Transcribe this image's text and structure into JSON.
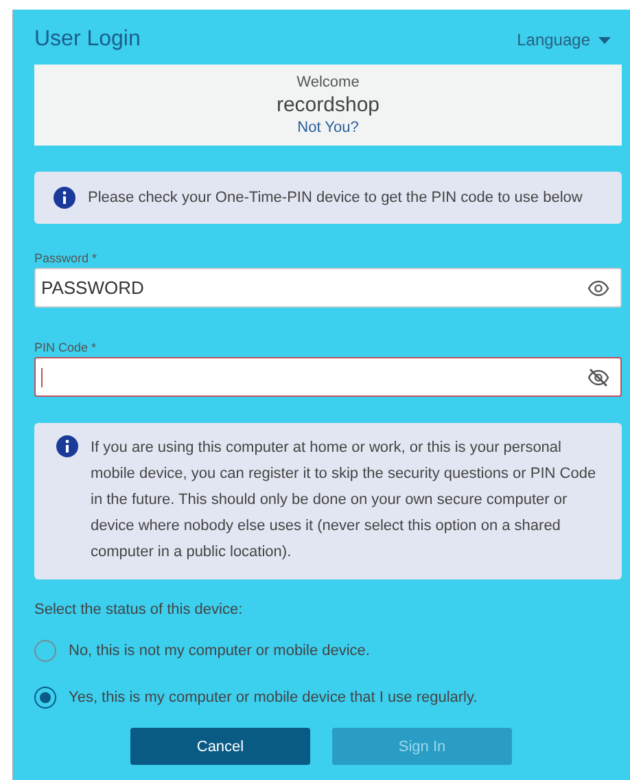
{
  "header": {
    "title": "User Login",
    "language": "Language"
  },
  "welcome": {
    "greeting": "Welcome",
    "username": "recordshop",
    "link": "Not You?"
  },
  "notice": "Please check your One-Time-PIN device to get the PIN code to use below",
  "fields": [
    {
      "label": "Password *",
      "value": "PASSWORD",
      "revealed": true,
      "invalid": false
    },
    {
      "label": "PIN Code *",
      "revealed": false,
      "invalid": true
    }
  ],
  "device_info": "If you are using this computer at home or work, or this is your personal mobile device, you can register it to skip the security questions or PIN Code in the future. This should only be done on your own secure computer or device where nobody else uses it (never select this option on a shared computer in a public location).",
  "device_status": {
    "label": "Select the status of this device:",
    "options": [
      {
        "label": "No, this is not my computer or mobile device.",
        "selected": false
      },
      {
        "label": "Yes, this is my computer or mobile device that I use regularly.",
        "selected": true
      }
    ]
  },
  "buttons": [
    {
      "label": "Cancel",
      "kind": "primary",
      "disabled": false
    },
    {
      "label": "Sign In",
      "kind": "primary",
      "disabled": true
    }
  ]
}
